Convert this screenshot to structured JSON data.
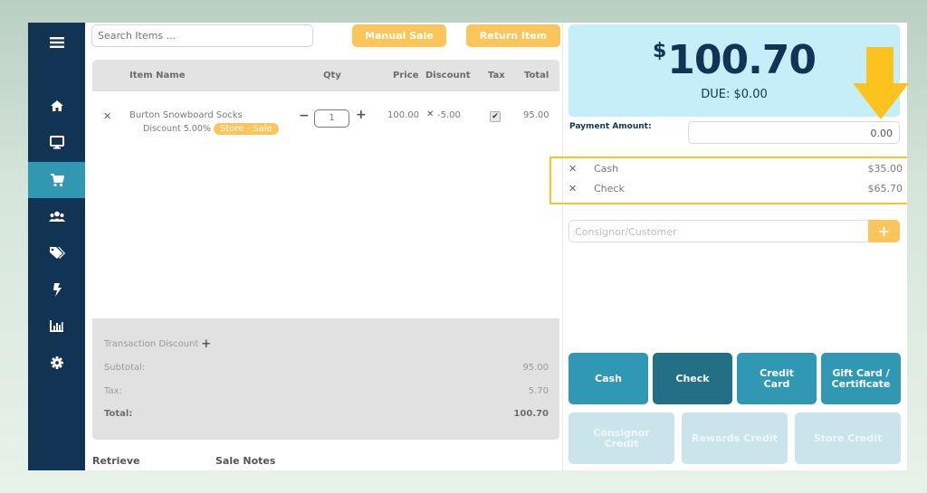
{
  "sidebar": {
    "items": [
      {
        "name": "menu",
        "icon": "hamburger-menu-icon"
      },
      {
        "name": "home",
        "icon": "home-icon"
      },
      {
        "name": "register",
        "icon": "monitor-icon"
      },
      {
        "name": "cart",
        "icon": "shopping-cart-icon",
        "active": true
      },
      {
        "name": "customers",
        "icon": "users-icon"
      },
      {
        "name": "inventory",
        "icon": "tags-icon"
      },
      {
        "name": "quick-actions",
        "icon": "lightning-bolt-icon"
      },
      {
        "name": "reports",
        "icon": "bar-chart-icon"
      },
      {
        "name": "settings",
        "icon": "gear-icon"
      }
    ]
  },
  "toolbar": {
    "search_placeholder": "Search Items ...",
    "manual_sale_label": "Manual Sale",
    "return_item_label": "Return Item"
  },
  "items_table": {
    "headers": {
      "item_name": "Item Name",
      "qty": "Qty",
      "price": "Price",
      "discount": "Discount",
      "tax": "Tax",
      "total": "Total"
    },
    "rows": [
      {
        "name": "Burton Snowboard Socks",
        "discount_note": "Discount 5.00%",
        "badge": "Store - Sale",
        "qty": "1",
        "price": "100.00",
        "discount": "-5.00",
        "taxable": true,
        "total": "95.00"
      }
    ]
  },
  "totals": {
    "transaction_discount_label": "Transaction Discount",
    "subtotal_label": "Subtotal:",
    "subtotal": "95.00",
    "tax_label": "Tax:",
    "tax": "5.70",
    "total_label": "Total:",
    "total": "100.70"
  },
  "footer_links": {
    "retrieve": "Retrieve",
    "sale_notes": "Sale Notes"
  },
  "payment": {
    "currency_symbol": "$",
    "total_amount": "100.70",
    "due_text": "DUE: $0.00",
    "amount_label": "Payment Amount:",
    "amount_value": "0.00",
    "applied": [
      {
        "method": "Cash",
        "amount": "$35.00"
      },
      {
        "method": "Check",
        "amount": "$65.70"
      }
    ],
    "customer_placeholder": "Consignor/Customer",
    "methods": [
      {
        "label": "Cash",
        "state": "enabled"
      },
      {
        "label": "Check",
        "state": "active"
      },
      {
        "label": "Credit\nCard",
        "state": "enabled"
      },
      {
        "label": "Gift Card /\nCertificate",
        "state": "enabled"
      }
    ],
    "credit_methods": [
      {
        "label": "Consignor\nCredit",
        "state": "disabled"
      },
      {
        "label": "Rewards Credit",
        "state": "disabled"
      },
      {
        "label": "Store Credit",
        "state": "disabled"
      }
    ]
  },
  "colors": {
    "sidebar_bg": "#123454",
    "sidebar_active": "#3198b3",
    "accent_orange": "#fcc55a",
    "highlight_yellow": "#f7c32e",
    "total_box_bg": "#c6eef8",
    "pay_button": "#3198b3",
    "pay_button_active": "#236f86",
    "pay_button_disabled": "#c9e4ea"
  }
}
